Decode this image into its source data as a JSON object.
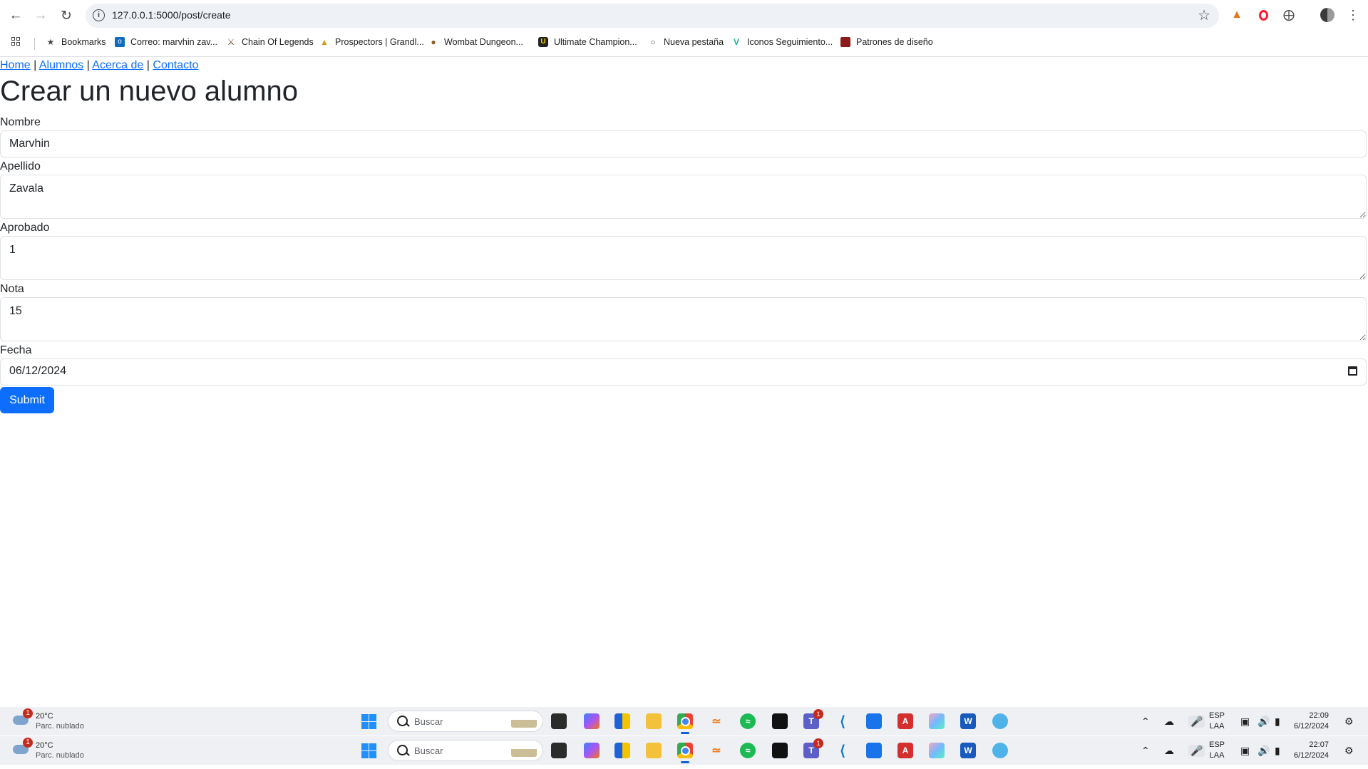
{
  "browser": {
    "url": "127.0.0.1:5000/post/create",
    "bookmarks": [
      {
        "label": "Bookmarks",
        "icon": "star-icon"
      },
      {
        "label": "Correo: marvhin zav...",
        "icon": "outlook-icon"
      },
      {
        "label": "Chain Of Legends",
        "icon": "chain-of-legends-icon"
      },
      {
        "label": "Prospectors | Grandl...",
        "icon": "prospectors-icon"
      },
      {
        "label": "Wombat Dungeon...",
        "icon": "wombat-icon"
      },
      {
        "label": "Ultimate Champion...",
        "icon": "ultimate-champions-icon"
      },
      {
        "label": "Nueva pestaña",
        "icon": "globe-icon"
      },
      {
        "label": "Iconos Seguimiento...",
        "icon": "vuetify-icon"
      },
      {
        "label": "Patrones de diseño",
        "icon": "design-patterns-icon"
      }
    ]
  },
  "page": {
    "nav": [
      {
        "label": "Home"
      },
      {
        "label": "Alumnos"
      },
      {
        "label": "Acerca de"
      },
      {
        "label": "Contacto"
      }
    ],
    "separator": "|",
    "title": "Crear un nuevo alumno",
    "form": {
      "nombre_label": "Nombre",
      "nombre_value": "Marvhin",
      "apellido_label": "Apellido",
      "apellido_value": "Zavala",
      "aprobado_label": "Aprobado",
      "aprobado_value": "1",
      "nota_label": "Nota",
      "nota_value": "15",
      "fecha_label": "Fecha",
      "fecha_value": "06/12/2024",
      "submit_label": "Submit"
    },
    "colors": {
      "link": "#0d6efd",
      "button": "#0d6efd"
    }
  },
  "taskbars": [
    {
      "weather_temp": "20°C",
      "weather_desc": "Parc. nublado",
      "weather_badge": "1",
      "search_placeholder": "Buscar",
      "teams_badge": "1",
      "lang_line1": "ESP",
      "lang_line2": "LAA",
      "time": "22:09",
      "date": "6/12/2024"
    },
    {
      "weather_temp": "20°C",
      "weather_desc": "Parc. nublado",
      "weather_badge": "1",
      "search_placeholder": "Buscar",
      "teams_badge": "1",
      "lang_line1": "ESP",
      "lang_line2": "LAA",
      "time": "22:07",
      "date": "6/12/2024"
    }
  ]
}
